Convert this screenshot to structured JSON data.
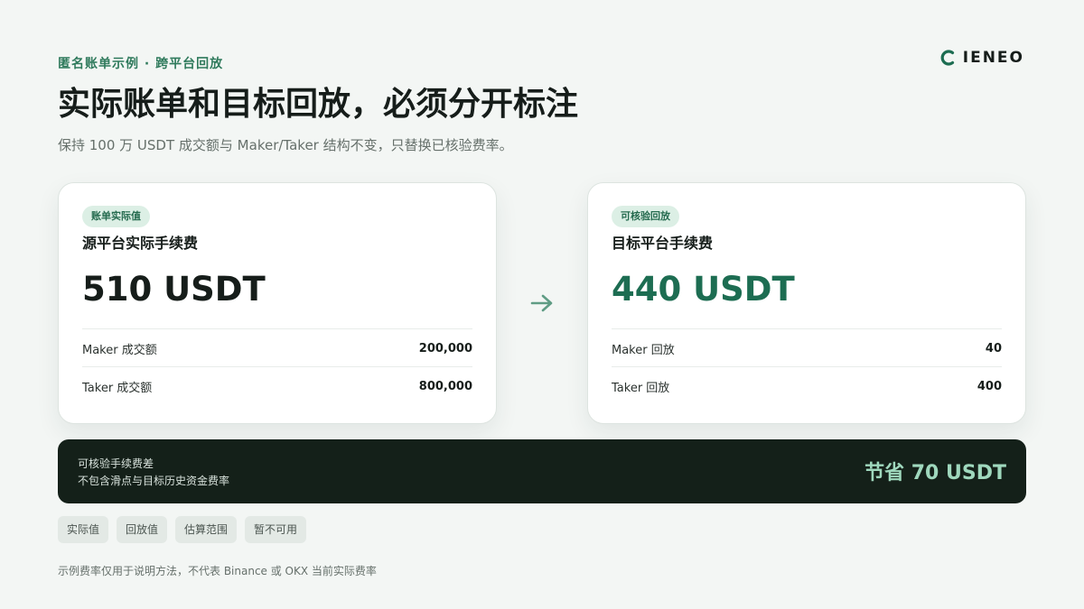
{
  "header": {
    "eyebrow": "匿名账单示例 · 跨平台回放",
    "brand": "IENEO",
    "headline": "实际账单和目标回放，必须分开标注",
    "subhead": "保持 100 万 USDT 成交额与 Maker/Taker 结构不变，只替换已核验费率。"
  },
  "source_card": {
    "tag": "账单实际值",
    "title": "源平台实际手续费",
    "amount": "510 USDT",
    "rows": [
      {
        "label": "Maker 成交额",
        "value": "200,000"
      },
      {
        "label": "Taker 成交额",
        "value": "800,000"
      }
    ]
  },
  "target_card": {
    "tag": "可核验回放",
    "title": "目标平台手续费",
    "amount": "440 USDT",
    "rows": [
      {
        "label": "Maker 回放",
        "value": "40"
      },
      {
        "label": "Taker 回放",
        "value": "400"
      }
    ]
  },
  "savings": {
    "label": "可核验手续费差",
    "note": "不包含滑点与目标历史资金费率",
    "amount": "节省 70 USDT"
  },
  "legend": [
    "实际值",
    "回放值",
    "估算范围",
    "暂不可用"
  ],
  "footnote": "示例费率仅用于说明方法，不代表 Binance 或 OKX 当前实际费率",
  "colors": {
    "accent": "#1d6d52",
    "background": "#f3f6f4",
    "dark_panel": "#142019",
    "savings_text": "#9fd8bd"
  },
  "icons": {
    "brand": "c-logo-icon",
    "transition": "arrow-right-icon"
  }
}
